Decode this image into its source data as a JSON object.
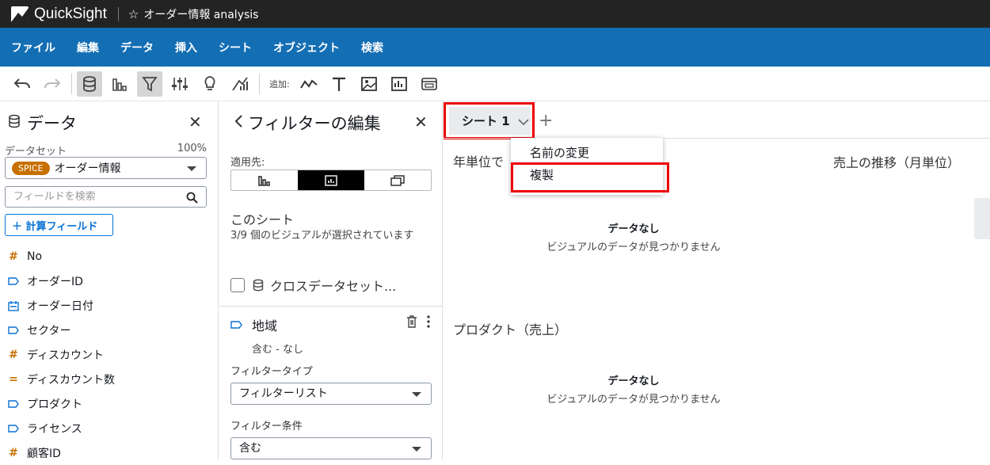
{
  "app": {
    "name": "QuickSight",
    "analysis_title": "オーダー情報 analysis"
  },
  "menu": [
    "ファイル",
    "編集",
    "データ",
    "挿入",
    "シート",
    "オブジェクト",
    "検索"
  ],
  "toolbar": {
    "add_label": "追加:"
  },
  "data_panel": {
    "title": "データ",
    "dataset_label": "データセット",
    "dataset_percent": "100%",
    "spice_badge": "SPICE",
    "dataset_name": "オーダー情報",
    "search_placeholder": "フィールドを検索",
    "calc_field_button": "＋ 計算フィールド",
    "fields": [
      {
        "name": "No",
        "type": "measure",
        "color": "#c76f00"
      },
      {
        "name": "オーダーID",
        "type": "dimension",
        "color": "#0972d3"
      },
      {
        "name": "オーダー日付",
        "type": "date",
        "color": "#0972d3"
      },
      {
        "name": "セクター",
        "type": "dimension",
        "color": "#0972d3"
      },
      {
        "name": "ディスカウント",
        "type": "measure",
        "color": "#c76f00"
      },
      {
        "name": "ディスカウント数",
        "type": "calculated",
        "color": "#c76f00"
      },
      {
        "name": "プロダクト",
        "type": "dimension",
        "color": "#0972d3"
      },
      {
        "name": "ライセンス",
        "type": "dimension",
        "color": "#0972d3"
      },
      {
        "name": "顧客ID",
        "type": "measure",
        "color": "#c76f00"
      }
    ]
  },
  "filter_panel": {
    "title": "フィルターの編集",
    "apply_to_label": "適用先:",
    "sheet_label": "このシート",
    "sheet_desc": "3/9 個のビジュアルが選択されています",
    "cross_dataset_label": "クロスデータセット...",
    "filter_name": "地域",
    "filter_summary": "含む - なし",
    "filter_type_label": "フィルタータイプ",
    "filter_type_value": "フィルターリスト",
    "filter_condition_label": "フィルター条件",
    "filter_condition_value": "含む"
  },
  "canvas": {
    "sheet_tab": "シート 1",
    "visual1_title": "年単位で",
    "visual2_title": "売上の推移（月単位）",
    "visual3_title": "プロダクト（売上）",
    "no_data_title": "データなし",
    "no_data_sub": "ビジュアルのデータが見つかりません"
  },
  "context_menu": {
    "rename": "名前の変更",
    "duplicate": "複製"
  },
  "colors": {
    "topbar": "#232323",
    "menubar": "#146eb4",
    "highlight": "#e00000",
    "spice": "#c76f00",
    "link": "#0972d3"
  }
}
